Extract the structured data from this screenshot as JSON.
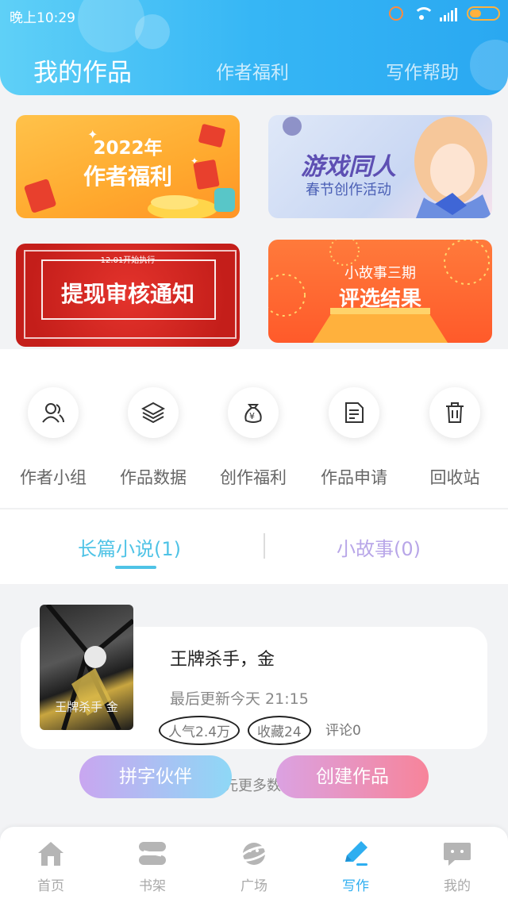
{
  "status_bar": {
    "time": "晚上10:29"
  },
  "header": {
    "tabs": [
      {
        "label": "我的作品",
        "active": true
      },
      {
        "label": "作者福利",
        "active": false
      },
      {
        "label": "写作帮助",
        "active": false
      }
    ]
  },
  "banners": [
    {
      "title_line1": "2022年",
      "title_line2": "作者福利"
    },
    {
      "title_line1": "游戏同人",
      "title_line2": "春节创作活动"
    },
    {
      "tag": "12.01开始执行",
      "title": "提现审核通知"
    },
    {
      "title_line1": "小故事三期",
      "title_line2": "评选结果"
    }
  ],
  "features": [
    {
      "label": "作者小组",
      "icon": "users-icon"
    },
    {
      "label": "作品数据",
      "icon": "layers-icon"
    },
    {
      "label": "创作福利",
      "icon": "money-bag-icon"
    },
    {
      "label": "作品申请",
      "icon": "document-icon"
    },
    {
      "label": "回收站",
      "icon": "trash-icon"
    }
  ],
  "subtabs": [
    {
      "label": "长篇小说(1)",
      "active": true
    },
    {
      "label": "小故事(0)",
      "active": false
    }
  ],
  "work": {
    "title": "王牌杀手，金",
    "cover_text": "王牌杀手 金",
    "last_update": "最后更新今天 21:15",
    "popularity": "人气2.4万",
    "favorites": "收藏24",
    "comments": "评论0"
  },
  "behind_text": "元更多数",
  "buttons": {
    "left": "拼字伙伴",
    "right": "创建作品"
  },
  "bottom_nav": [
    {
      "label": "首页",
      "icon": "home-icon",
      "active": false
    },
    {
      "label": "书架",
      "icon": "bookshelf-icon",
      "active": false
    },
    {
      "label": "广场",
      "icon": "planet-icon",
      "active": false
    },
    {
      "label": "写作",
      "icon": "pen-icon",
      "active": true
    },
    {
      "label": "我的",
      "icon": "chat-icon",
      "active": false
    }
  ],
  "colors": {
    "header_start": "#5fd0f7",
    "header_end": "#2aa8f1",
    "accent": "#2eaef0",
    "subtab_active": "#4fc3e6",
    "subtab_inactive": "#b8a6e8"
  }
}
